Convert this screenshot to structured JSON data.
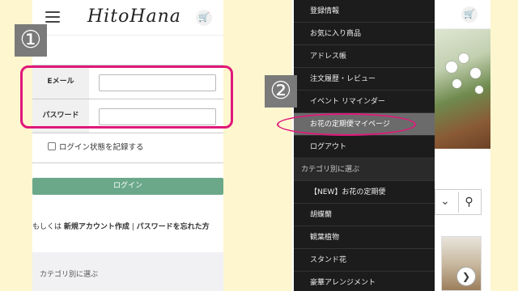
{
  "left_phone": {
    "logo": "HitoHana",
    "cart_icon": "cart-icon",
    "form": {
      "email_label": "Eメール",
      "password_label": "パスワード",
      "email_value": "",
      "password_value": ""
    },
    "remember_label": "ログイン状態を記録する",
    "login_button": "ログイン",
    "alt_prefix": "もしくは ",
    "new_account_link": "新規アカウント作成",
    "separator": " | ",
    "forgot_link": "パスワードを忘れた方",
    "category_footer": "カテゴリ別に選ぶ"
  },
  "badges": {
    "one": "①",
    "two": "②"
  },
  "menu": {
    "items_top": [
      "登録情報",
      "お気に入り商品",
      "アドレス帳",
      "注文履歴・レビュー",
      "イベント リマインダー",
      "お花の定期便マイページ",
      "ログアウト"
    ],
    "active_index": 5,
    "section_label": "カテゴリ別に選ぶ",
    "items_bottom": [
      "【NEW】お花の定期便",
      "胡蝶蘭",
      "観葉植物",
      "スタンド花",
      "豪華アレンジメント"
    ]
  },
  "right_phone": {
    "chevron_icon": "chevron-down-icon",
    "search_icon": "search-icon",
    "next_icon": "chevron-right-icon"
  },
  "colors": {
    "highlight": "#e0187b",
    "login_button": "#6aa889",
    "menu_bg": "#1c1c1c",
    "background": "#fdf6cf"
  }
}
